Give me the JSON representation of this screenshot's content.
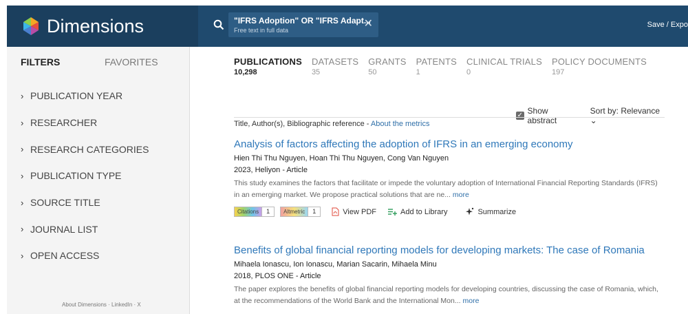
{
  "header": {
    "brand": "Dimensions",
    "search_chip": {
      "query": "\"IFRS Adoption\" OR \"IFRS Adapt...",
      "scope": "Free text in full data"
    },
    "save_export": "Save / Expo"
  },
  "sidebar": {
    "tabs": {
      "filters": "FILTERS",
      "favorites": "FAVORITES"
    },
    "filters": [
      "PUBLICATION YEAR",
      "RESEARCHER",
      "RESEARCH CATEGORIES",
      "PUBLICATION TYPE",
      "SOURCE TITLE",
      "JOURNAL LIST",
      "OPEN ACCESS"
    ],
    "footer": "About Dimensions · LinkedIn · X"
  },
  "main": {
    "tabs": [
      {
        "label": "PUBLICATIONS",
        "count": "10,298",
        "active": true
      },
      {
        "label": "DATASETS",
        "count": "35"
      },
      {
        "label": "GRANTS",
        "count": "50"
      },
      {
        "label": "PATENTS",
        "count": "1"
      },
      {
        "label": "CLINICAL TRIALS",
        "count": "0"
      },
      {
        "label": "POLICY DOCUMENTS",
        "count": "197"
      }
    ],
    "show_abstract": "Show abstract",
    "sort_by": "Sort by: Relevance",
    "metric_line": "Title, Author(s), Bibliographic reference - ",
    "metric_link": "About the metrics",
    "results": [
      {
        "title": "Analysis of factors affecting the adoption of IFRS in an emerging economy",
        "authors": "Hien Thi Thu Nguyen, Hoan Thi Thu Nguyen, Cong Van Nguyen",
        "meta": "2023, Heliyon - Article",
        "abstract": "This study examines the factors that facilitate or impede the voluntary adoption of International Financial Reporting Standards (IFRS) in an emerging market. We propose practical solutions that are ne...",
        "more": "more",
        "citations_label": "Citations",
        "citations": "1",
        "altmetric_label": "Altmetric",
        "altmetric": "1",
        "view_pdf": "View PDF",
        "add_library": "Add to Library",
        "summarize": "Summarize"
      },
      {
        "title": "Benefits of global financial reporting models for developing markets: The case of Romania",
        "authors": "Mihaela Ionascu, Ion Ionascu, Marian Sacarin, Mihaela Minu",
        "meta": "2018, PLOS ONE - Article",
        "abstract": "The paper explores the benefits of global financial reporting models for developing countries, discussing the case of Romania, which, at the recommendations of the World Bank and the International Mon...",
        "more": "more"
      }
    ]
  },
  "colors": {
    "header_bg": "#1f4a6e",
    "brand_bg": "#1b3f5e",
    "link": "#2f78b9",
    "sidebar_bg": "#f4f4f4"
  }
}
